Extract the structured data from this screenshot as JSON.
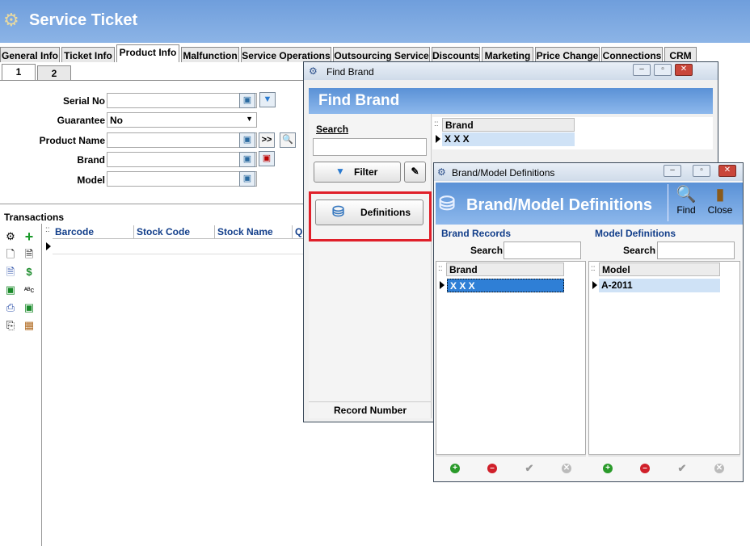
{
  "main": {
    "title": "Service Ticket",
    "tabs": [
      "General Info",
      "Ticket Info",
      "Product Info",
      "Malfunction",
      "Service Operations",
      "Outsourcing Service",
      "Discounts",
      "Marketing",
      "Price Change",
      "Connections",
      "CRM"
    ],
    "subtabs": [
      "1",
      "2"
    ],
    "fields": {
      "serial_label": "Serial No",
      "guarantee_label": "Guarantee",
      "guarantee_value": "No",
      "product_label": "Product Name",
      "brand_label": "Brand",
      "model_label": "Model",
      "more_btn": ">>"
    },
    "transactions": {
      "title": "Transactions",
      "columns": [
        "Barcode",
        "Stock Code",
        "Stock Name",
        "Q"
      ]
    }
  },
  "find_brand": {
    "window_title": "Find Brand",
    "header": "Find Brand",
    "search_label": "Search",
    "filter_btn": "Filter",
    "definitions_btn": "Definitions",
    "grid_header": "Brand",
    "grid_rows": [
      "X X X"
    ],
    "footer": "Record Number",
    "highlight_color": "#e0202a"
  },
  "bm_defs": {
    "window_title": "Brand/Model Definitions",
    "header": "Brand/Model Definitions",
    "find_label": "Find",
    "close_label": "Close",
    "brand_section": "Brand Records",
    "model_section": "Model Definitions",
    "search_label": "Search",
    "brand_header": "Brand",
    "brand_rows": [
      "X X X"
    ],
    "model_header": "Model",
    "model_rows": [
      "A-2011"
    ]
  }
}
